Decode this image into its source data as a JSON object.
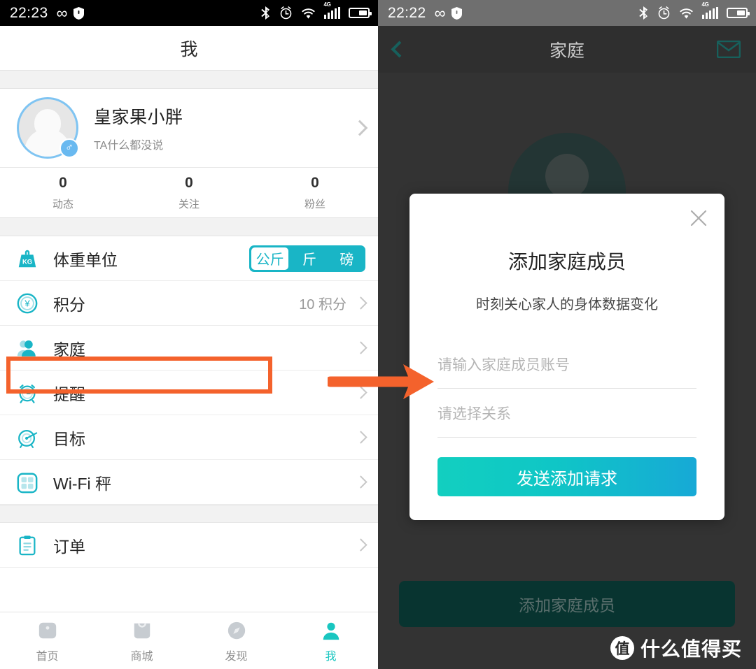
{
  "left_phone": {
    "status_bar": {
      "time": "22:23",
      "icons_left": [
        "infinity-icon",
        "shield-icon"
      ],
      "icons_right": [
        "bluetooth-icon",
        "alarm-icon",
        "wifi-icon",
        "signal-4g-icon",
        "battery-icon"
      ],
      "network_label": "4G"
    },
    "nav": {
      "title": "我"
    },
    "profile": {
      "name": "皇家果小胖",
      "signature": "TA什么都没说",
      "gender_symbol": "♂",
      "chevron": "chevron-right-icon"
    },
    "stats": [
      {
        "num": "0",
        "label": "动态"
      },
      {
        "num": "0",
        "label": "关注"
      },
      {
        "num": "0",
        "label": "粉丝"
      }
    ],
    "rows_group_1": [
      {
        "icon": "weight-kg-icon",
        "label": "体重单位",
        "control": "segmented"
      },
      {
        "icon": "coin-yen-icon",
        "label": "积分",
        "value": "10 积分"
      },
      {
        "icon": "person-icon",
        "label": "家庭",
        "highlighted": true
      },
      {
        "icon": "alarm-clock-icon",
        "label": "提醒"
      },
      {
        "icon": "target-icon",
        "label": "目标"
      },
      {
        "icon": "wifi-scale-icon",
        "label": "Wi-Fi 秤"
      }
    ],
    "rows_group_2": [
      {
        "icon": "clipboard-icon",
        "label": "订单"
      }
    ],
    "weight_unit_options": [
      "公斤",
      "斤",
      "磅"
    ],
    "weight_unit_selected": "公斤",
    "tabbar": [
      {
        "icon": "home-icon",
        "label": "首页",
        "active": false
      },
      {
        "icon": "shop-bag-icon",
        "label": "商城",
        "active": false
      },
      {
        "icon": "compass-icon",
        "label": "发现",
        "active": false
      },
      {
        "icon": "profile-icon",
        "label": "我",
        "active": true
      }
    ]
  },
  "right_phone": {
    "status_bar": {
      "time": "22:22",
      "network_label": "4G"
    },
    "nav": {
      "back": "back-chevron-icon",
      "title": "家庭",
      "mail": "mail-icon"
    },
    "bottom_button": "添加家庭成员",
    "watermark": {
      "logo": "值",
      "text": "什么值得买"
    },
    "modal": {
      "close": "close-icon",
      "title": "添加家庭成员",
      "subtitle": "时刻关心家人的身体数据变化",
      "account_placeholder": "请输入家庭成员账号",
      "relation_placeholder": "请选择关系",
      "submit_label": "发送添加请求"
    }
  },
  "annotation": {
    "highlight_color": "#f4622c",
    "arrow_color": "#f4622c",
    "highlight_target": "家庭"
  },
  "colors": {
    "accent_teal": "#19b5c6",
    "accent_cyan": "#19c6c0",
    "avatar_ring": "#7fc4f2",
    "annotation_orange": "#f4622c",
    "button_gradient_start": "#12cfc0",
    "button_gradient_end": "#17a9d6"
  }
}
